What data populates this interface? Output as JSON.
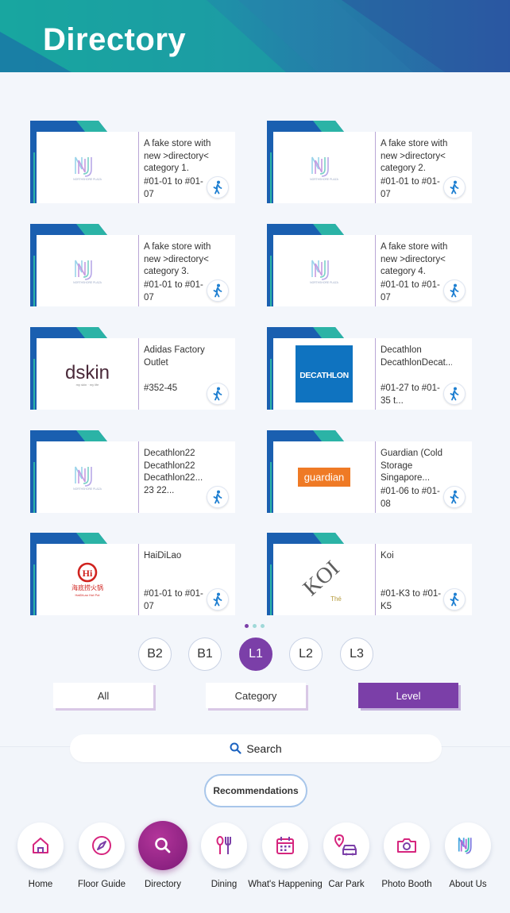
{
  "header": {
    "title": "Directory"
  },
  "stores": [
    {
      "logo": "northshore-plaza",
      "name": "A fake store with new >directory< category 1.",
      "unit": "#01-01 to #01-07"
    },
    {
      "logo": "northshore-plaza",
      "name": "A fake store with new >directory< category 2.",
      "unit": "#01-01 to #01-07"
    },
    {
      "logo": "northshore-plaza",
      "name": "A fake store with new >directory< category 3.",
      "unit": "#01-01 to #01-07"
    },
    {
      "logo": "northshore-plaza",
      "name": "A fake store with new >directory< category 4.",
      "unit": "#01-01 to #01-07"
    },
    {
      "logo": "dskin",
      "name": "Adidas Factory Outlet",
      "unit": "#352-45"
    },
    {
      "logo": "decathlon",
      "name": "Decathlon DecathlonDecat...",
      "unit": "#01-27 to #01-35 t..."
    },
    {
      "logo": "northshore-plaza",
      "name": "Decathlon22 Decathlon22 Decathlon22... 23 22...",
      "unit": ""
    },
    {
      "logo": "guardian",
      "name": "Guardian (Cold Storage Singapore...",
      "unit": "#01-06 to #01-08"
    },
    {
      "logo": "haidilao",
      "name": "HaiDiLao",
      "unit": "#01-01 to #01-07"
    },
    {
      "logo": "koi",
      "name": "Koi",
      "unit": "#01-K3 to #01-K5"
    }
  ],
  "logo_text": {
    "northshore": "NORTHSHORE PLAZA",
    "dskin": "dskin",
    "dskin_tagline": "my skin · my life",
    "decathlon": "DECATHLON",
    "guardian": "guardian",
    "haidilao_cn": "海底捞火锅",
    "haidilao_en": "HaiDiLao Hot Pot",
    "koi": "KOI",
    "koi_sub": "Thé"
  },
  "pagination": {
    "pages": 3,
    "current": 1
  },
  "levels": [
    "B2",
    "B1",
    "L1",
    "L2",
    "L3"
  ],
  "active_level": "L1",
  "tabs": [
    {
      "label": "All",
      "active": false
    },
    {
      "label": "Category",
      "active": false
    },
    {
      "label": "Level",
      "active": true
    }
  ],
  "search": {
    "label": "Search"
  },
  "recommendations": {
    "label": "Recommendations"
  },
  "nav": [
    {
      "label": "Home",
      "icon": "home-icon"
    },
    {
      "label": "Floor Guide",
      "icon": "compass-icon"
    },
    {
      "label": "Directory",
      "icon": "search-icon",
      "active": true
    },
    {
      "label": "Dining",
      "icon": "dining-icon"
    },
    {
      "label": "What's Happening",
      "icon": "calendar-icon"
    },
    {
      "label": "Car Park",
      "icon": "car-park-icon"
    },
    {
      "label": "Photo Booth",
      "icon": "camera-icon"
    },
    {
      "label": "About Us",
      "icon": "northshore-logo-icon"
    }
  ],
  "colors": {
    "accent": "#7b3fa8",
    "header_start": "#16a5a0",
    "header_end": "#2a59a5",
    "nav_active": "#9a2a8c",
    "icon_pink": "#d6257e",
    "walk_blue": "#1e7fd1"
  }
}
